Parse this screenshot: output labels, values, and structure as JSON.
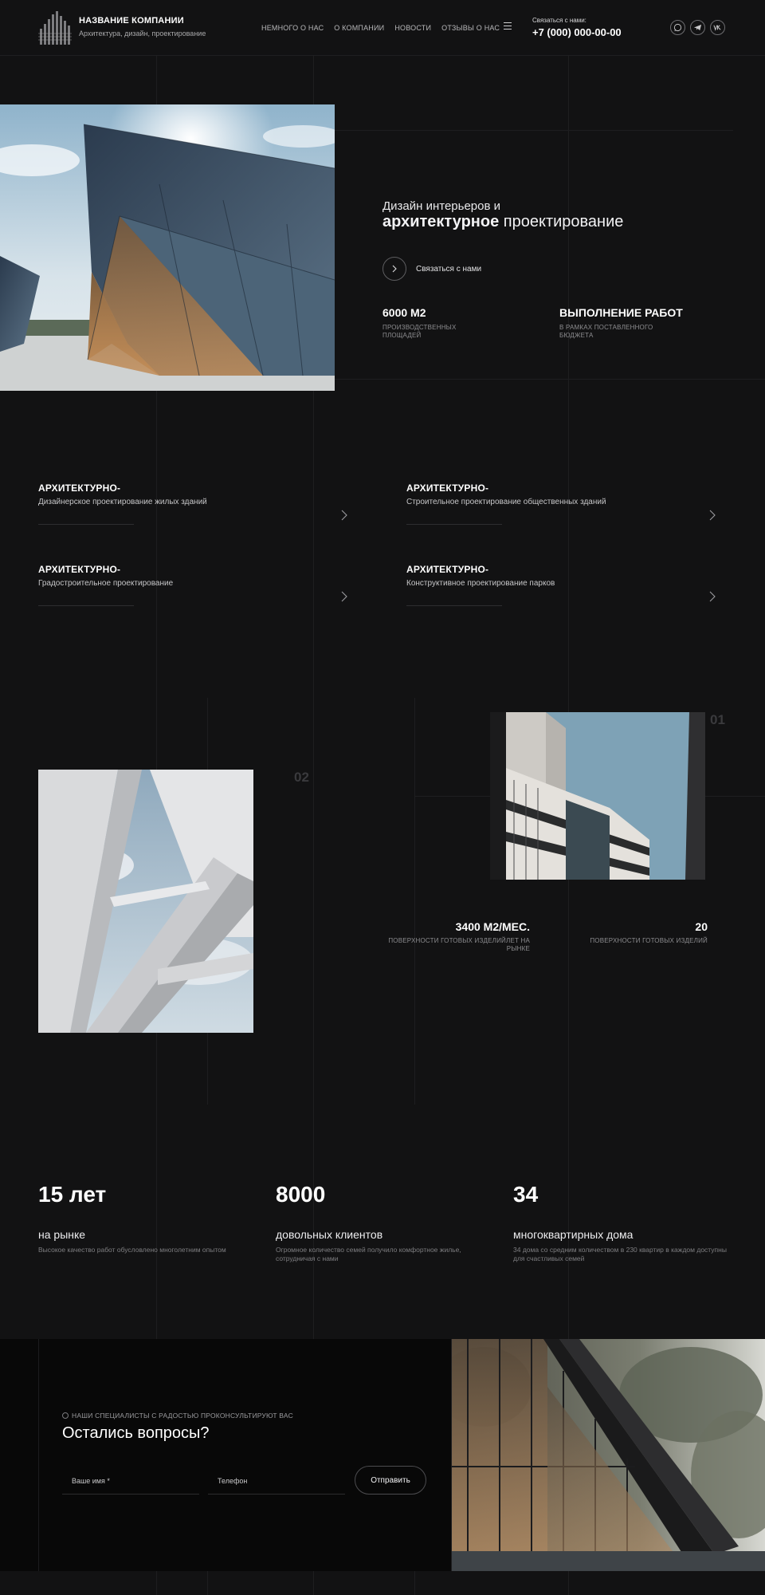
{
  "header": {
    "company_name": "НАЗВАНИЕ КОМПАНИИ",
    "company_subtitle": "Архитектура, дизайн, проектирование",
    "nav": [
      "НЕМНОГО О НАС",
      "О КОМПАНИИ",
      "НОВОСТИ",
      "ОТЗЫВЫ О НАС"
    ],
    "contact_label": "Связаться с нами:",
    "phone": "+7 (000) 000-00-00",
    "socials": [
      "whatsapp-icon",
      "telegram-icon",
      "vk-icon"
    ]
  },
  "hero": {
    "line1": "Дизайн интерьеров и",
    "line2_bold": "архитектурное",
    "line2_rest": " проектирование",
    "button_label": "Связаться с нами",
    "stats": [
      {
        "value": "6000 М2",
        "label": "ПРОИЗВОДСТВЕННЫХ ПЛОЩАДЕЙ"
      },
      {
        "value": "ВЫПОЛНЕНИЕ РАБОТ",
        "label": "В РАМКАХ ПОСТАВЛЕННОГО БЮДЖЕТА"
      }
    ]
  },
  "services": [
    {
      "title": "АРХИТЕКТУРНО-",
      "desc": "Дизайнерское проектирование жилых зданий"
    },
    {
      "title": "АРХИТЕКТУРНО-",
      "desc": "Строительное проектирование общественных зданий"
    },
    {
      "title": "АРХИТЕКТУРНО-",
      "desc": "Градостроительное проектирование"
    },
    {
      "title": "АРХИТЕКТУРНО-",
      "desc": "Конструктивное проектирование парков"
    }
  ],
  "projects": {
    "num_left": "02",
    "num_right": "01",
    "stats": [
      {
        "value": "3400 М2/МЕС.",
        "label": "ПОВЕРХНОСТИ ГОТОВЫХ ИЗДЕЛИЙЛЕТ НА РЫНКЕ"
      },
      {
        "value": "20",
        "label": "ПОВЕРХНОСТИ ГОТОВЫХ ИЗДЕЛИЙ"
      }
    ]
  },
  "numbers": [
    {
      "value": "15 лет",
      "title": "на рынке",
      "desc": "Высокое качество работ обусловлено многолетним опытом"
    },
    {
      "value": "8000",
      "title": "довольных клиентов",
      "desc": "Огромное количество семей получило комфортное жилье, сотрудничая с нами"
    },
    {
      "value": "34",
      "title": "многоквартирных дома",
      "desc": "34 дома со средним количеством в 230 квартир в каждом доступны для счастливых семей"
    }
  ],
  "contact_form": {
    "kicker": "НАШИ СПЕЦИАЛИСТЫ С РАДОСТЬЮ ПРОКОНСУЛЬТИРУЮТ ВАС",
    "title": "Остались вопросы?",
    "name_placeholder": "Ваше имя *",
    "phone_placeholder": "Телефон",
    "submit_label": "Отправить"
  },
  "colors": {
    "background": "#121213",
    "cta_background": "#080808",
    "muted_text": "#8d8d90",
    "number_watermark": "#3a3a3d"
  }
}
